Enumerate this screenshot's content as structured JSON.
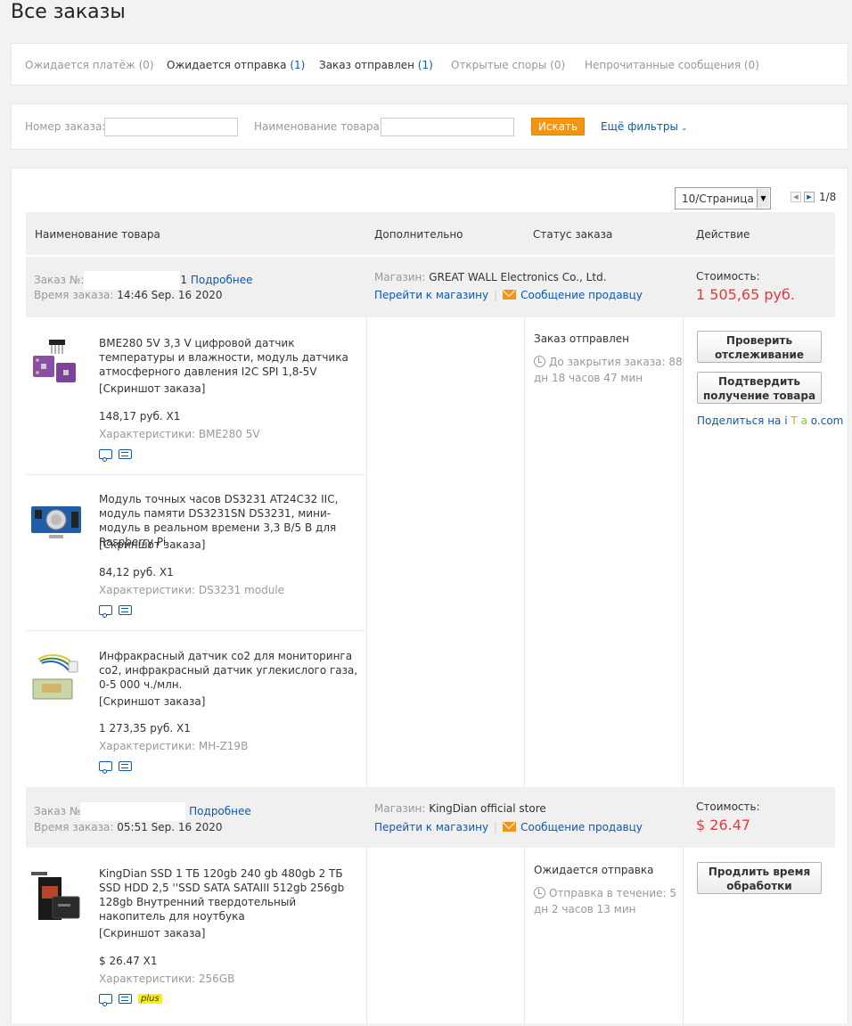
{
  "page": {
    "title": "Все заказы"
  },
  "tabs": [
    {
      "label": "Ожидается платёж",
      "count": "(0)"
    },
    {
      "label": "Ожидается отправка",
      "count": "(1)"
    },
    {
      "label": "Заказ отправлен",
      "count": "(1)"
    },
    {
      "label": "Открытые споры",
      "count": "(0)"
    },
    {
      "label": "Непрочитанные сообщения",
      "count": "(0)"
    }
  ],
  "filters": {
    "order_number_label": "Номер заказа:",
    "order_number_value": "",
    "product_name_label": "Наименование товара:",
    "product_name_value": "",
    "search_label": "Искать",
    "more_filters_label": "Ещё фильтры"
  },
  "pager": {
    "per_page": "10/Страница",
    "page": "1/8"
  },
  "table_headers": {
    "product": "Наименование товара",
    "additional": "Дополнительно",
    "status": "Статус заказа",
    "action": "Действие"
  },
  "orders": [
    {
      "order_label": "Заказ №:",
      "order_suffix": "1",
      "details_link": "Подробнее",
      "time_label": "Время заказа:",
      "time_value": "14:46 Sep. 16 2020",
      "store_label": "Магазин:",
      "store_name": "GREAT WALL Electronics Co., Ltd.",
      "go_to_store": "Перейти к магазину",
      "separator": "|",
      "message_seller": "Сообщение продавцу",
      "cost_label": "Стоимость:",
      "cost_value": "1 505,65 руб.",
      "status": "Заказ отправлен",
      "timer_text": "До закрытия заказа: 88 дн 18 часов 47 мин",
      "buttons": [
        "Проверить отслеживание",
        "Подтвердить получение товара"
      ],
      "share": {
        "prefix": "Поделиться на ",
        "brand_i": "i",
        "brand_t": "T",
        "brand_a": "a",
        "brand_o": "o",
        "brand_com": ".com"
      },
      "items": [
        {
          "name": "BME280 5V 3,3 V цифровой датчик температуры и влажности, модуль датчика атмосферного давления I2C SPI 1,8-5V",
          "snapshot": "[Скриншот заказа]",
          "price": "148,17 руб. X1",
          "spec": "Характеристики: BME280 5V"
        },
        {
          "name": "Модуль точных часов DS3231 AT24C32 IIC, модуль памяти DS3231SN DS3231, мини-модуль в реальном времени 3,3 В/5 В для Raspberry Pi",
          "snapshot": "[Скриншот заказа]",
          "price": "84,12 руб. X1",
          "spec": "Характеристики: DS3231 module"
        },
        {
          "name": "Инфракрасный датчик co2 для мониторинга co2, инфракрасный датчик углекислого газа, 0-5 000 ч./млн.",
          "snapshot": "[Скриншот заказа]",
          "price": "1 273,35 руб. X1",
          "spec": "Характеристики: MH-Z19B"
        }
      ]
    },
    {
      "order_label": "Заказ №",
      "order_suffix": "",
      "details_link": "Подробнее",
      "time_label": "Время заказа:",
      "time_value": "05:51 Sep. 16 2020",
      "store_label": "Магазин:",
      "store_name": "KingDian official store",
      "go_to_store": "Перейти к магазину",
      "separator": "|",
      "message_seller": "Сообщение продавцу",
      "cost_label": "Стоимость:",
      "cost_value": "$ 26.47",
      "status": "Ожидается отправка",
      "timer_text": "Отправка в течение: 5 дн 2 часов 13 мин",
      "buttons": [
        "Продлить время обработки"
      ],
      "items": [
        {
          "name": "KingDian SSD 1 ТБ 120gb 240 gb 480gb 2 ТБ SSD HDD 2,5 ''SSD SATA SATAIII 512gb 256gb 128gb Внутренний твердотельный накопитель для ноутбука",
          "snapshot": "[Скриншот заказа]",
          "price": "$ 26.47 X1",
          "spec": "Характеристики: 256GB",
          "badge": "plus"
        }
      ]
    }
  ]
}
